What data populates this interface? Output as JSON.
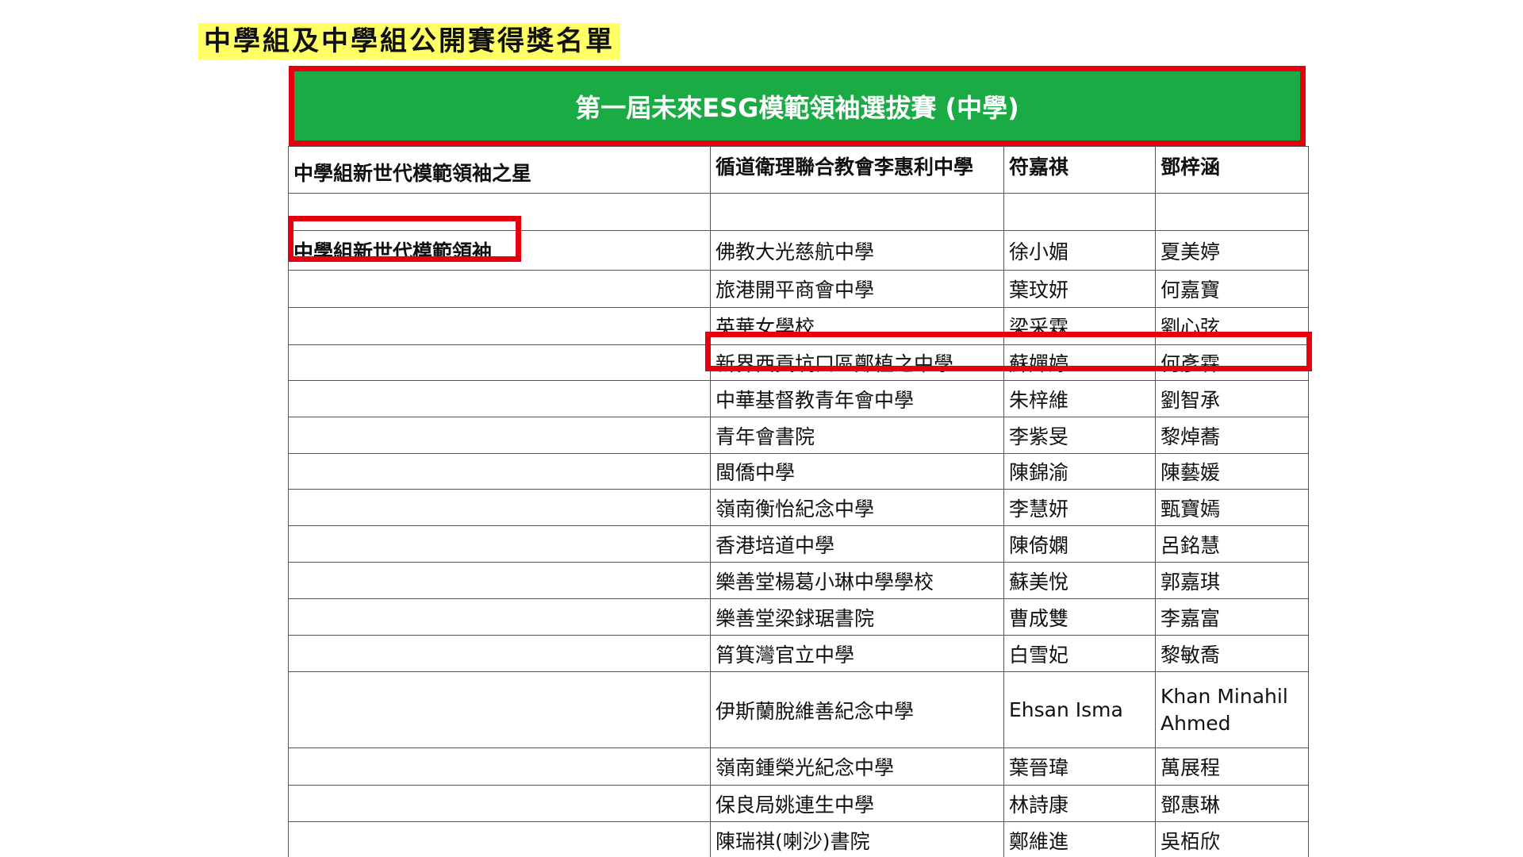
{
  "heading": "中學組及中學組公開賽得獎名單",
  "banner": {
    "title": "第一屆未來ESG模範領袖選拔賽 (中學)"
  },
  "colors": {
    "banner_green": "#1bab44",
    "highlight_red": "#e3000f",
    "heading_yellow": "#ffff66"
  },
  "table": {
    "star_row": {
      "category": "中學組新世代模範領袖之星",
      "school": "循道衛理聯合教會李惠利中學",
      "student1": "符嘉祺",
      "student2": "鄧梓涵"
    },
    "leader_category": "中學組新世代模範領袖",
    "rows": [
      {
        "school": "佛教大光慈航中學",
        "student1": "徐小媚",
        "student2": "夏美婷"
      },
      {
        "school": "旅港開平商會中學",
        "student1": "葉玟妍",
        "student2": "何嘉寶"
      },
      {
        "school": "英華女學校",
        "student1": "梁采霖",
        "student2": "劉心弦"
      },
      {
        "school": "新界西貢坑口區鄭植之中學",
        "student1": "蘇嬋婷",
        "student2": "何彥霖"
      },
      {
        "school": "中華基督教青年會中學",
        "student1": "朱梓維",
        "student2": "劉智承"
      },
      {
        "school": "青年會書院",
        "student1": "李紫旻",
        "student2": "黎焯蕎"
      },
      {
        "school": "閩僑中學",
        "student1": "陳錦渝",
        "student2": "陳藝媛"
      },
      {
        "school": "嶺南衡怡紀念中學",
        "student1": "李慧妍",
        "student2": "甄寶嫣"
      },
      {
        "school": "香港培道中學",
        "student1": "陳倚嫻",
        "student2": "呂銘慧"
      },
      {
        "school": "樂善堂楊葛小琳中學學校",
        "student1": "蘇美悅",
        "student2": "郭嘉琪"
      },
      {
        "school": "樂善堂梁銶琚書院",
        "student1": "曹成雙",
        "student2": "李嘉富"
      },
      {
        "school": "筲箕灣官立中學",
        "student1": "白雪妃",
        "student2": "黎敏喬"
      },
      {
        "school": "伊斯蘭脫維善紀念中學",
        "student1": "Ehsan Isma",
        "student2": "Khan Minahil Ahmed"
      },
      {
        "school": "嶺南鍾榮光紀念中學",
        "student1": "葉晉瑋",
        "student2": "萬展程"
      },
      {
        "school": "保良局姚連生中學",
        "student1": "林詩康",
        "student2": "鄧惠琳"
      },
      {
        "school": "陳瑞祺(喇沙)書院",
        "student1": "鄭維進",
        "student2": "吳栢欣"
      }
    ]
  }
}
